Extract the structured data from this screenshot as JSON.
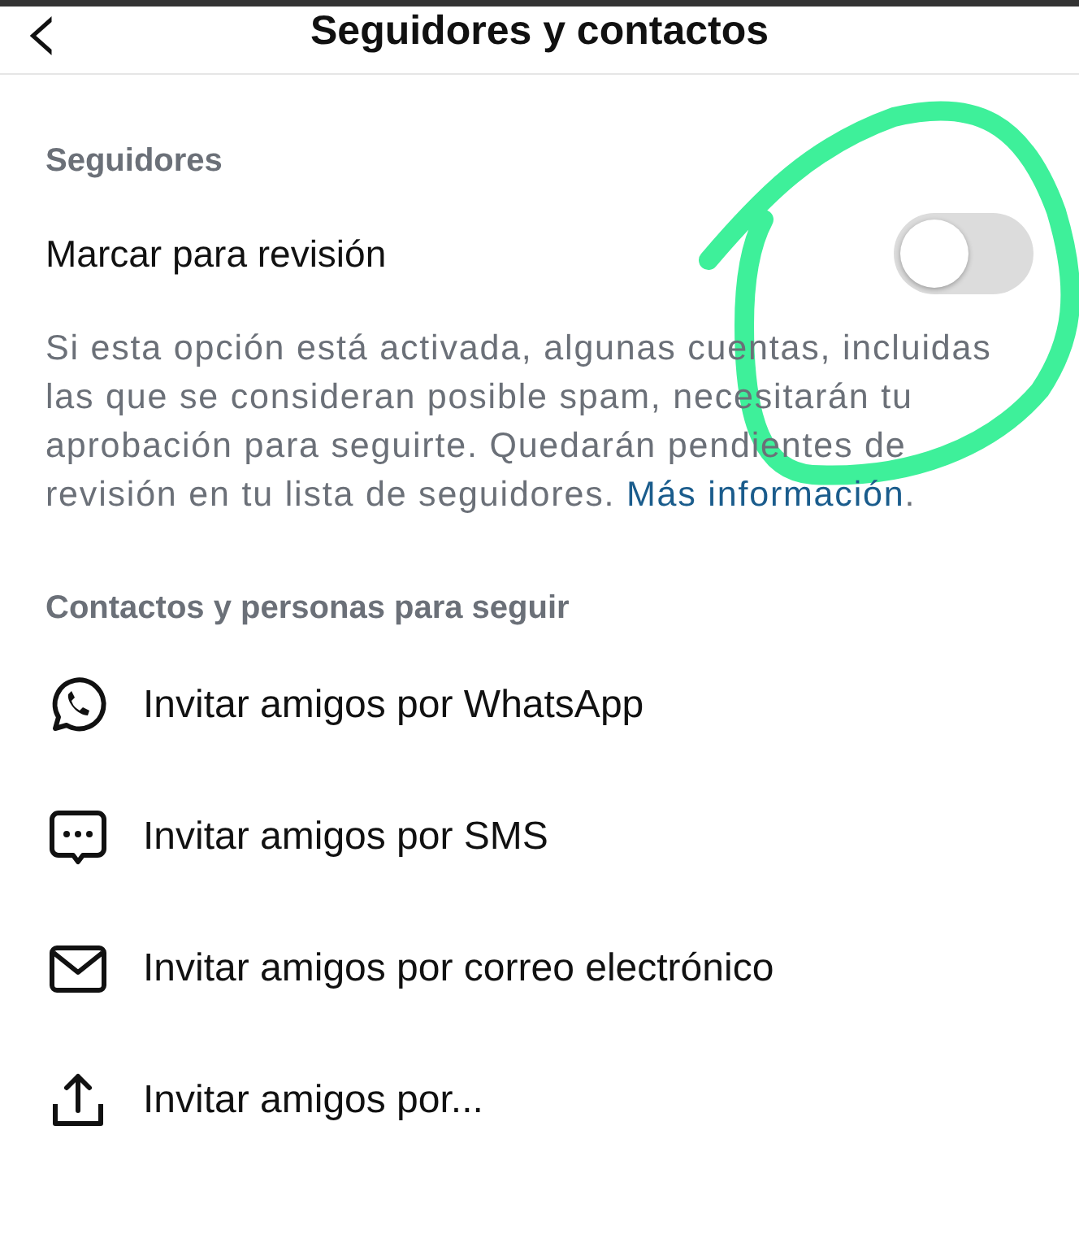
{
  "header": {
    "back_icon": "‹",
    "title": "Seguidores y contactos"
  },
  "followers_section": {
    "heading": "Seguidores",
    "toggle": {
      "label": "Marcar para revisión",
      "on": false
    },
    "description": "Si esta opción está activada, algunas cuentas, incluidas las que se consideran posible spam, necesitarán tu aprobación para seguirte. Quedarán pendientes de revisión en tu lista de seguidores.",
    "link": "Más información",
    "link_suffix": "."
  },
  "contacts_section": {
    "heading": "Contactos y personas para seguir",
    "items": [
      {
        "kind": "whatsapp",
        "label": "Invitar amigos por WhatsApp"
      },
      {
        "kind": "sms",
        "label": "Invitar amigos por SMS"
      },
      {
        "kind": "email",
        "label": "Invitar amigos por correo electrónico"
      },
      {
        "kind": "share",
        "label": "Invitar amigos por..."
      }
    ]
  }
}
